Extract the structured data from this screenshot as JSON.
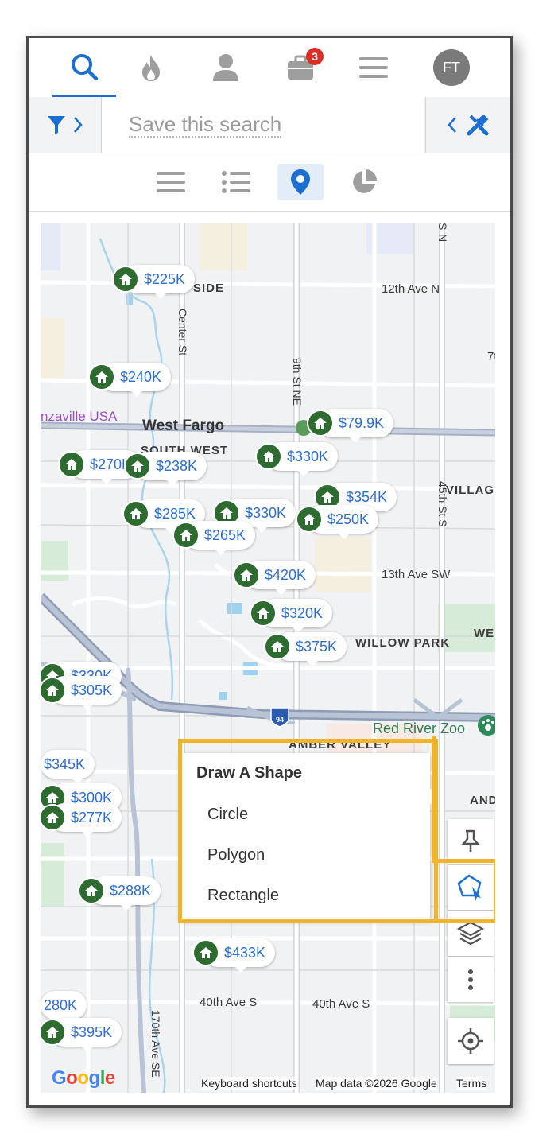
{
  "topnav": {
    "items": [
      {
        "icon": "search-icon"
      },
      {
        "icon": "fire-icon"
      },
      {
        "icon": "user-icon"
      },
      {
        "icon": "briefcase-icon",
        "badge": "3"
      },
      {
        "icon": "menu-icon"
      }
    ],
    "avatar_initials": "FT"
  },
  "searchbar": {
    "save_label": "Save this search"
  },
  "view_tabs": [
    "list-view",
    "detail-list-view",
    "map-view",
    "chart-view"
  ],
  "map": {
    "area_labels": {
      "side": "SIDE",
      "west_fargo": "West Fargo",
      "south_west": "SOUTH WEST",
      "village": "VILLAG",
      "willow_park": "WILLOW PARK",
      "we": "WE",
      "amber_valley": "AMBER VALLEY",
      "and": "AND",
      "red_river_zoo": "Red River Zoo",
      "bonanzaville": "nzaville USA"
    },
    "street_labels": {
      "ave_12": "12th Ave N",
      "ave_13": "13th Ave SW",
      "ave_40_a": "40th Ave S",
      "ave_40_b": "40th Ave S",
      "center_st": "Center St",
      "st_9": "9th St NE",
      "st_45": "45th St S",
      "ave_170": "170th Ave SE",
      "s_top": "S",
      "n_top": "N",
      "s_7t": "7t",
      "highway": "94"
    },
    "listings": [
      {
        "price": "$225K"
      },
      {
        "price": "$240K"
      },
      {
        "price": "$79.9K"
      },
      {
        "price": "$270K"
      },
      {
        "price": "$238K"
      },
      {
        "price": "$330K"
      },
      {
        "price": "$354K"
      },
      {
        "price": "$285K"
      },
      {
        "price": "$330K"
      },
      {
        "price": "$250K"
      },
      {
        "price": "$265K"
      },
      {
        "price": "$420K"
      },
      {
        "price": "$320K"
      },
      {
        "price": "$375K"
      },
      {
        "price": "$330K"
      },
      {
        "price": "$305K"
      },
      {
        "price": "$345K"
      },
      {
        "price": "$300K"
      },
      {
        "price": "$277K"
      },
      {
        "price": "$288K"
      },
      {
        "price": "$433K"
      },
      {
        "price": "280K"
      },
      {
        "price": "$395K"
      }
    ],
    "draw_menu": {
      "title": "Draw A Shape",
      "options": [
        "Circle",
        "Polygon",
        "Rectangle"
      ]
    },
    "controls": [
      "pin-icon",
      "draw-polygon-icon",
      "layers-icon",
      "more-vertical-icon",
      "locate-icon"
    ],
    "logo": "Google",
    "attribution": {
      "shortcuts": "Keyboard shortcuts",
      "data": "Map data ©2026 Google",
      "terms": "Terms"
    }
  },
  "colors": {
    "accent": "#1c6fd1",
    "marker": "#2e6b30",
    "price": "#2f6fcb",
    "highlight": "#f0b429",
    "badge": "#d93025"
  }
}
